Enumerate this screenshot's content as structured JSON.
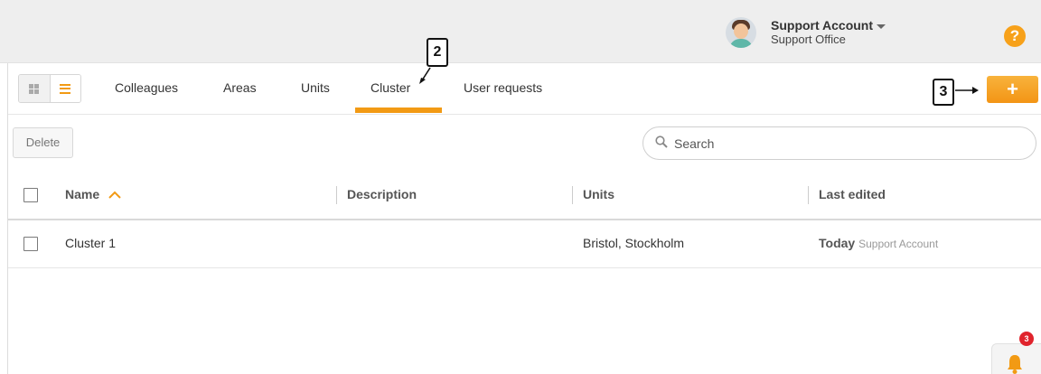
{
  "header": {
    "user_name": "Support Account",
    "user_office": "Support Office",
    "help_symbol": "?"
  },
  "tabs": [
    {
      "label": "Colleagues",
      "active": false
    },
    {
      "label": "Areas",
      "active": false
    },
    {
      "label": "Units",
      "active": false
    },
    {
      "label": "Cluster",
      "active": true
    },
    {
      "label": "User requests",
      "active": false
    }
  ],
  "toolbar": {
    "add_symbol": "+",
    "delete_label": "Delete",
    "search_placeholder": "Search"
  },
  "annotations": {
    "tab_marker": "2",
    "add_marker": "3"
  },
  "table": {
    "columns": [
      "Name",
      "Description",
      "Units",
      "Last edited"
    ],
    "sort_column": "Name",
    "rows": [
      {
        "name": "Cluster 1",
        "description": "",
        "units": "Bristol, Stockholm",
        "last_edited_when": "Today",
        "last_edited_by": "Support Account"
      }
    ]
  },
  "notifications": {
    "count": "3"
  },
  "colors": {
    "accent": "#f29a14",
    "badge": "#e0232c",
    "header_bg": "#eeeeee"
  },
  "icons": [
    "help-icon",
    "grid-view-icon",
    "list-view-icon",
    "plus-icon",
    "search-icon",
    "sort-ascending-icon",
    "bell-icon",
    "avatar"
  ]
}
